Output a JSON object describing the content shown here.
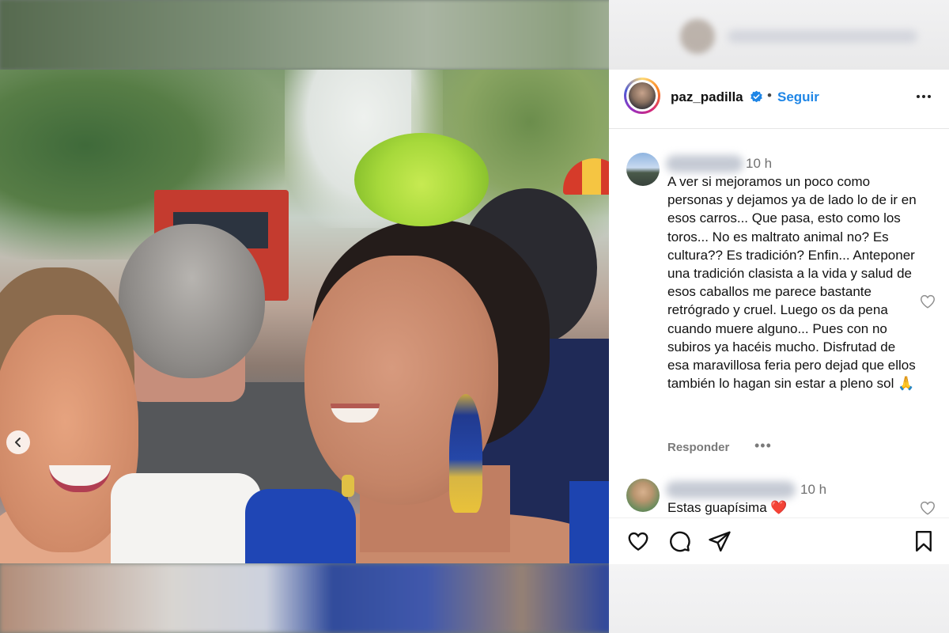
{
  "post": {
    "username": "paz_padilla",
    "separator": "•",
    "follow_label": "Seguir"
  },
  "icons": {
    "verified": "verified-badge-icon",
    "more": "more-options-icon",
    "prev": "chevron-left-icon",
    "like": "heart-icon",
    "comment": "comment-icon",
    "share": "share-icon",
    "save": "bookmark-icon"
  },
  "colors": {
    "follow_blue": "#1f86e6",
    "verified_blue": "#1f86e6",
    "heart_red": "#e0245e"
  },
  "comments": [
    {
      "time": "10 h",
      "text": "A ver si mejoramos un poco como personas y dejamos ya de lado lo de ir en esos carros... Que pasa, esto como los toros... No es maltrato animal no? Es cultura?? Es tradición? Enfin... Anteponer una tradición clasista a la vida y salud de esos caballos me parece bastante retrógrado y cruel. Luego os da pena cuando muere alguno... Pues con no subiros ya hacéis mucho. Disfrutad de esa maravillosa feria pero dejad que ellos también lo hagan sin estar a pleno sol 🙏",
      "reply_label": "Responder",
      "more_label": "•••"
    },
    {
      "time": "10 h",
      "text": "Estas guapísima ❤️"
    }
  ]
}
